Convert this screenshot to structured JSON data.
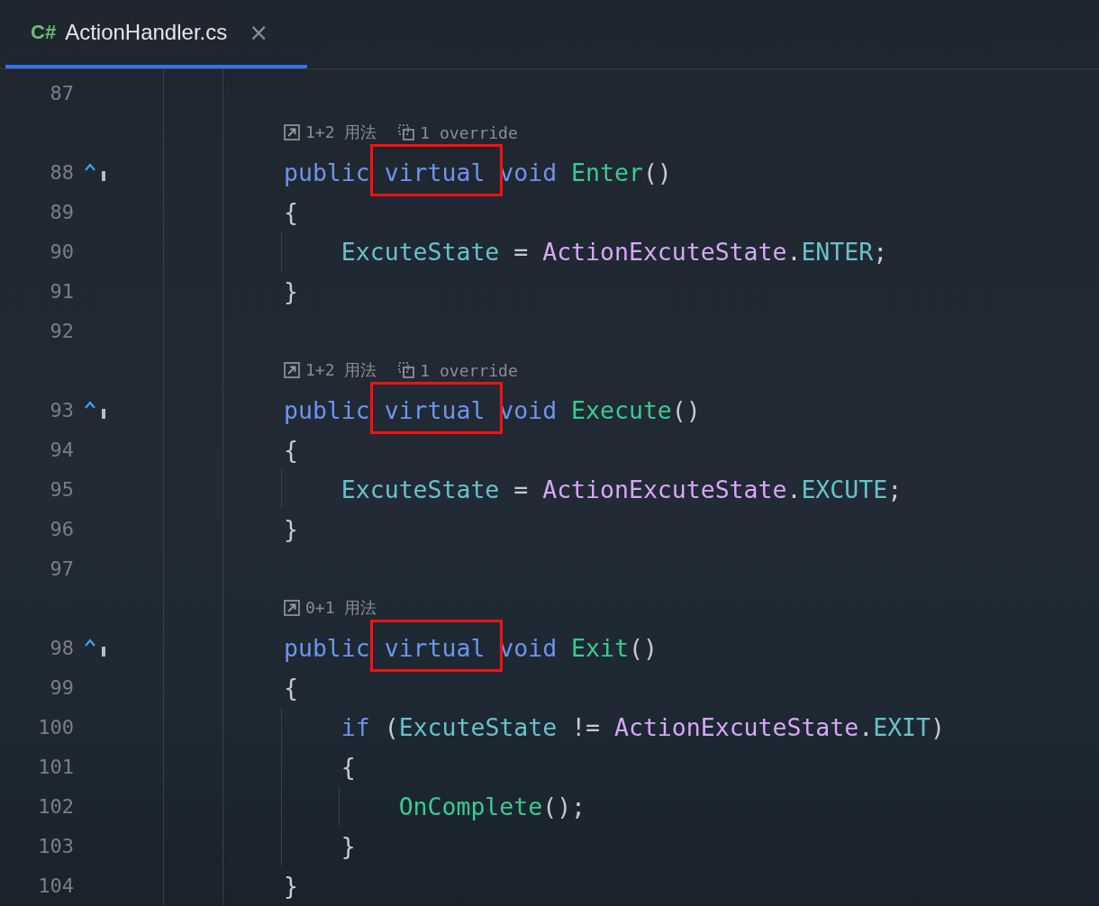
{
  "tab": {
    "language_badge": "C#",
    "label": "ActionHandler.cs",
    "close": "×",
    "selected": true
  },
  "editor": {
    "rows": [
      {
        "kind": "code",
        "number": "87",
        "marker": false
      },
      {
        "kind": "hint",
        "items": [
          {
            "kind": "usages",
            "text": "1+2 用法"
          },
          {
            "kind": "override",
            "text": "1 override"
          }
        ]
      },
      {
        "kind": "code",
        "number": "88",
        "marker": true,
        "tokens": [
          {
            "text": "public ",
            "color": "#6c95eb"
          },
          {
            "text": "virtual",
            "color": "#6c95eb",
            "boxed": true
          },
          {
            "text": " void ",
            "color": "#6c95eb"
          },
          {
            "text": "Enter",
            "color": "#39cc8f"
          },
          {
            "text": "()",
            "color": "#c8cbd0"
          }
        ]
      },
      {
        "kind": "code",
        "number": "89",
        "marker": false,
        "tokens": [
          {
            "text": "{",
            "color": "#c8cbd0"
          }
        ]
      },
      {
        "kind": "code",
        "number": "90",
        "marker": false,
        "tokens": [
          {
            "text": "    ExcuteState",
            "color": "#66c3cc"
          },
          {
            "text": " = ",
            "color": "#c8cbd0"
          },
          {
            "text": "ActionExcuteState",
            "color": "#d7a8f5"
          },
          {
            "text": ".",
            "color": "#c8cbd0"
          },
          {
            "text": "ENTER",
            "color": "#66c3cc"
          },
          {
            "text": ";",
            "color": "#c8cbd0"
          }
        ]
      },
      {
        "kind": "code",
        "number": "91",
        "marker": false,
        "tokens": [
          {
            "text": "}",
            "color": "#c8cbd0"
          }
        ]
      },
      {
        "kind": "code",
        "number": "92",
        "marker": false
      },
      {
        "kind": "hint",
        "items": [
          {
            "kind": "usages",
            "text": "1+2 用法"
          },
          {
            "kind": "override",
            "text": "1 override"
          }
        ]
      },
      {
        "kind": "code",
        "number": "93",
        "marker": true,
        "tokens": [
          {
            "text": "public ",
            "color": "#6c95eb"
          },
          {
            "text": "virtual",
            "color": "#6c95eb",
            "boxed": true
          },
          {
            "text": " void ",
            "color": "#6c95eb"
          },
          {
            "text": "Execute",
            "color": "#39cc8f"
          },
          {
            "text": "()",
            "color": "#c8cbd0"
          }
        ]
      },
      {
        "kind": "code",
        "number": "94",
        "marker": false,
        "tokens": [
          {
            "text": "{",
            "color": "#c8cbd0"
          }
        ]
      },
      {
        "kind": "code",
        "number": "95",
        "marker": false,
        "tokens": [
          {
            "text": "    ExcuteState",
            "color": "#66c3cc"
          },
          {
            "text": " = ",
            "color": "#c8cbd0"
          },
          {
            "text": "ActionExcuteState",
            "color": "#d7a8f5"
          },
          {
            "text": ".",
            "color": "#c8cbd0"
          },
          {
            "text": "EXCUTE",
            "color": "#66c3cc"
          },
          {
            "text": ";",
            "color": "#c8cbd0"
          }
        ]
      },
      {
        "kind": "code",
        "number": "96",
        "marker": false,
        "tokens": [
          {
            "text": "}",
            "color": "#c8cbd0"
          }
        ]
      },
      {
        "kind": "code",
        "number": "97",
        "marker": false
      },
      {
        "kind": "hint",
        "items": [
          {
            "kind": "usages",
            "text": "0+1 用法"
          }
        ]
      },
      {
        "kind": "code",
        "number": "98",
        "marker": true,
        "tokens": [
          {
            "text": "public ",
            "color": "#6c95eb"
          },
          {
            "text": "virtual",
            "color": "#6c95eb",
            "boxed": true
          },
          {
            "text": " void ",
            "color": "#6c95eb"
          },
          {
            "text": "Exit",
            "color": "#39cc8f"
          },
          {
            "text": "()",
            "color": "#c8cbd0"
          }
        ]
      },
      {
        "kind": "code",
        "number": "99",
        "marker": false,
        "tokens": [
          {
            "text": "{",
            "color": "#c8cbd0"
          }
        ]
      },
      {
        "kind": "code",
        "number": "100",
        "marker": false,
        "tokens": [
          {
            "text": "    if",
            "color": "#6c95eb"
          },
          {
            "text": " (",
            "color": "#c8cbd0"
          },
          {
            "text": "ExcuteState",
            "color": "#66c3cc"
          },
          {
            "text": " != ",
            "color": "#c8cbd0"
          },
          {
            "text": "ActionExcuteState",
            "color": "#d7a8f5"
          },
          {
            "text": ".",
            "color": "#c8cbd0"
          },
          {
            "text": "EXIT",
            "color": "#66c3cc"
          },
          {
            "text": ")",
            "color": "#c8cbd0"
          }
        ]
      },
      {
        "kind": "code",
        "number": "101",
        "marker": false,
        "tokens": [
          {
            "text": "    {",
            "color": "#c8cbd0"
          }
        ]
      },
      {
        "kind": "code",
        "number": "102",
        "marker": false,
        "tokens": [
          {
            "text": "        OnComplete",
            "color": "#39cc8f"
          },
          {
            "text": "();",
            "color": "#c8cbd0"
          }
        ]
      },
      {
        "kind": "code",
        "number": "103",
        "marker": false,
        "tokens": [
          {
            "text": "    }",
            "color": "#c8cbd0"
          }
        ]
      },
      {
        "kind": "code",
        "number": "104",
        "marker": false,
        "tokens": [
          {
            "text": "}",
            "color": "#c8cbd0"
          }
        ]
      }
    ]
  }
}
